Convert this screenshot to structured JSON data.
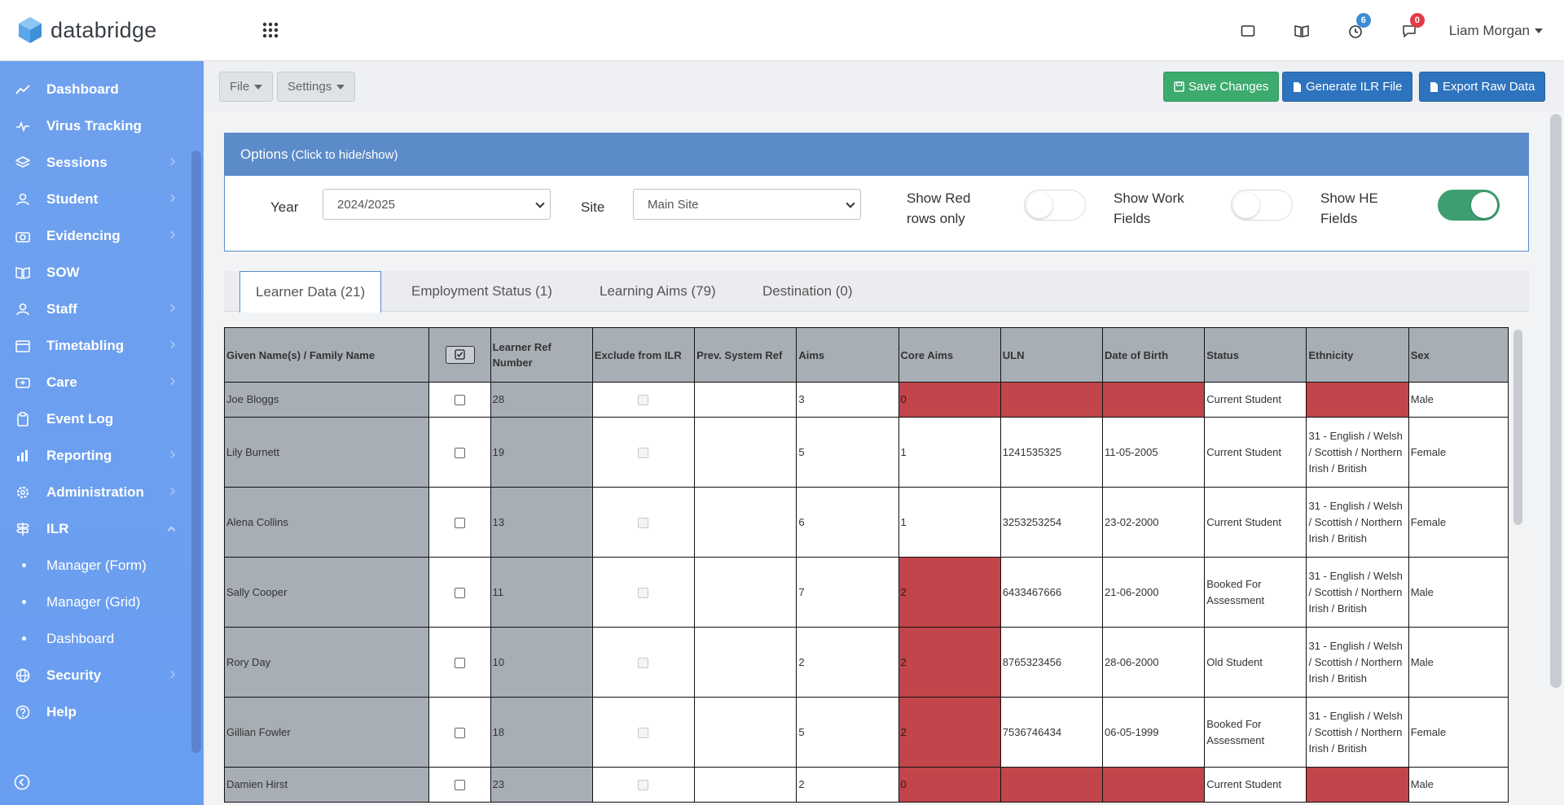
{
  "brand": {
    "name": "databridge"
  },
  "header": {
    "icons": [
      "tablet-icon",
      "book-icon",
      "clock-icon",
      "chat-icon"
    ],
    "notifications_count": "6",
    "messages_count": "0",
    "user_name": "Liam Morgan"
  },
  "sidebar": {
    "items": [
      {
        "label": "Dashboard",
        "icon": "chart-line-icon"
      },
      {
        "label": "Virus Tracking",
        "icon": "heartbeat-icon"
      },
      {
        "label": "Sessions",
        "icon": "layers-icon"
      },
      {
        "label": "Student",
        "icon": "user-icon"
      },
      {
        "label": "Evidencing",
        "icon": "camera-icon"
      },
      {
        "label": "SOW",
        "icon": "book-open-icon"
      },
      {
        "label": "Staff",
        "icon": "user-icon"
      },
      {
        "label": "Timetabling",
        "icon": "calendar-icon"
      },
      {
        "label": "Care",
        "icon": "care-icon"
      },
      {
        "label": "Event Log",
        "icon": "clipboard-icon"
      },
      {
        "label": "Reporting",
        "icon": "bar-chart-icon"
      },
      {
        "label": "Administration",
        "icon": "gear-icon"
      },
      {
        "label": "ILR",
        "icon": "signpost-icon"
      }
    ],
    "ilr_sub": [
      "Manager (Form)",
      "Manager (Grid)",
      "Dashboard"
    ],
    "bottom_items": [
      {
        "label": "Security",
        "icon": "globe-icon"
      },
      {
        "label": "Help",
        "icon": "help-icon"
      }
    ]
  },
  "toolbar": {
    "file_label": "File",
    "settings_label": "Settings",
    "save_label": "Save Changes",
    "generate_label": "Generate ILR File",
    "export_label": "Export Raw Data"
  },
  "options": {
    "title": "Options",
    "hint": "(Click to hide/show)",
    "year_label": "Year",
    "year_value": "2024/2025",
    "site_label": "Site",
    "site_value": "Main Site",
    "red_rows_label_1": "Show Red",
    "red_rows_label_2": "rows only",
    "work_fields_label_1": "Show Work",
    "work_fields_label_2": "Fields",
    "he_fields_label_1": "Show HE",
    "he_fields_label_2": "Fields",
    "red_rows_on": false,
    "work_fields_on": false,
    "he_fields_on": true
  },
  "tabs": [
    "Learner Data (21)",
    "Employment Status (1)",
    "Learning Aims (79)",
    "Destination (0)"
  ],
  "table": {
    "headers": {
      "name": "Given Name(s) / Family Name",
      "ref_1": "Learner Ref",
      "ref_2": "Number",
      "exclude": "Exclude from ILR",
      "prev": "Prev. System Ref",
      "aims": "Aims",
      "core": "Core Aims",
      "uln": "ULN",
      "dob": "Date of Birth",
      "status": "Status",
      "ethnicity": "Ethnicity",
      "sex": "Sex"
    },
    "rows": [
      {
        "name": "Joe Bloggs",
        "ref": "28",
        "aims": "3",
        "core": "0",
        "uln": "",
        "dob": "",
        "status": "Current Student",
        "ethnicity": "",
        "sex": "Male",
        "red_core": true,
        "red_uln": true,
        "red_dob": true,
        "red_eth": true
      },
      {
        "name": "Lily Burnett",
        "ref": "19",
        "aims": "5",
        "core": "1",
        "uln": "1241535325",
        "dob": "11-05-2005",
        "status": "Current Student",
        "ethnicity": "31 - English / Welsh / Scottish / Northern Irish / British",
        "sex": "Female",
        "red_core": false
      },
      {
        "name": "Alena Collins",
        "ref": "13",
        "aims": "6",
        "core": "1",
        "uln": "3253253254",
        "dob": "23-02-2000",
        "status": "Current Student",
        "ethnicity": "31 - English / Welsh / Scottish / Northern Irish / British",
        "sex": "Female",
        "red_core": false
      },
      {
        "name": "Sally Cooper",
        "ref": "11",
        "aims": "7",
        "core": "2",
        "uln": "6433467666",
        "dob": "21-06-2000",
        "status": "Booked For Assessment",
        "ethnicity": "31 - English / Welsh / Scottish / Northern Irish / British",
        "sex": "Male",
        "red_core": true
      },
      {
        "name": "Rory Day",
        "ref": "10",
        "aims": "2",
        "core": "2",
        "uln": "8765323456",
        "dob": "28-06-2000",
        "status": "Old Student",
        "ethnicity": "31 - English / Welsh / Scottish / Northern Irish / British",
        "sex": "Male",
        "red_core": true
      },
      {
        "name": "Gillian Fowler",
        "ref": "18",
        "aims": "5",
        "core": "2",
        "uln": "7536746434",
        "dob": "06-05-1999",
        "status": "Booked For Assessment",
        "ethnicity": "31 - English / Welsh / Scottish / Northern Irish / British",
        "sex": "Female",
        "red_core": true
      },
      {
        "name": "Damien Hirst",
        "ref": "23",
        "aims": "2",
        "core": "0",
        "uln": "",
        "dob": "",
        "status": "Current Student",
        "ethnicity": "",
        "sex": "Male",
        "red_core": true,
        "red_uln": true,
        "red_dob": true,
        "red_eth": true
      }
    ]
  },
  "colors": {
    "sidebar": "#6ea0ee",
    "panel_header": "#5b8bc9",
    "save": "#3daa6e",
    "primary": "#2e73bd",
    "error_cell": "#c1454a",
    "toggle_on": "#3d9f6f"
  }
}
